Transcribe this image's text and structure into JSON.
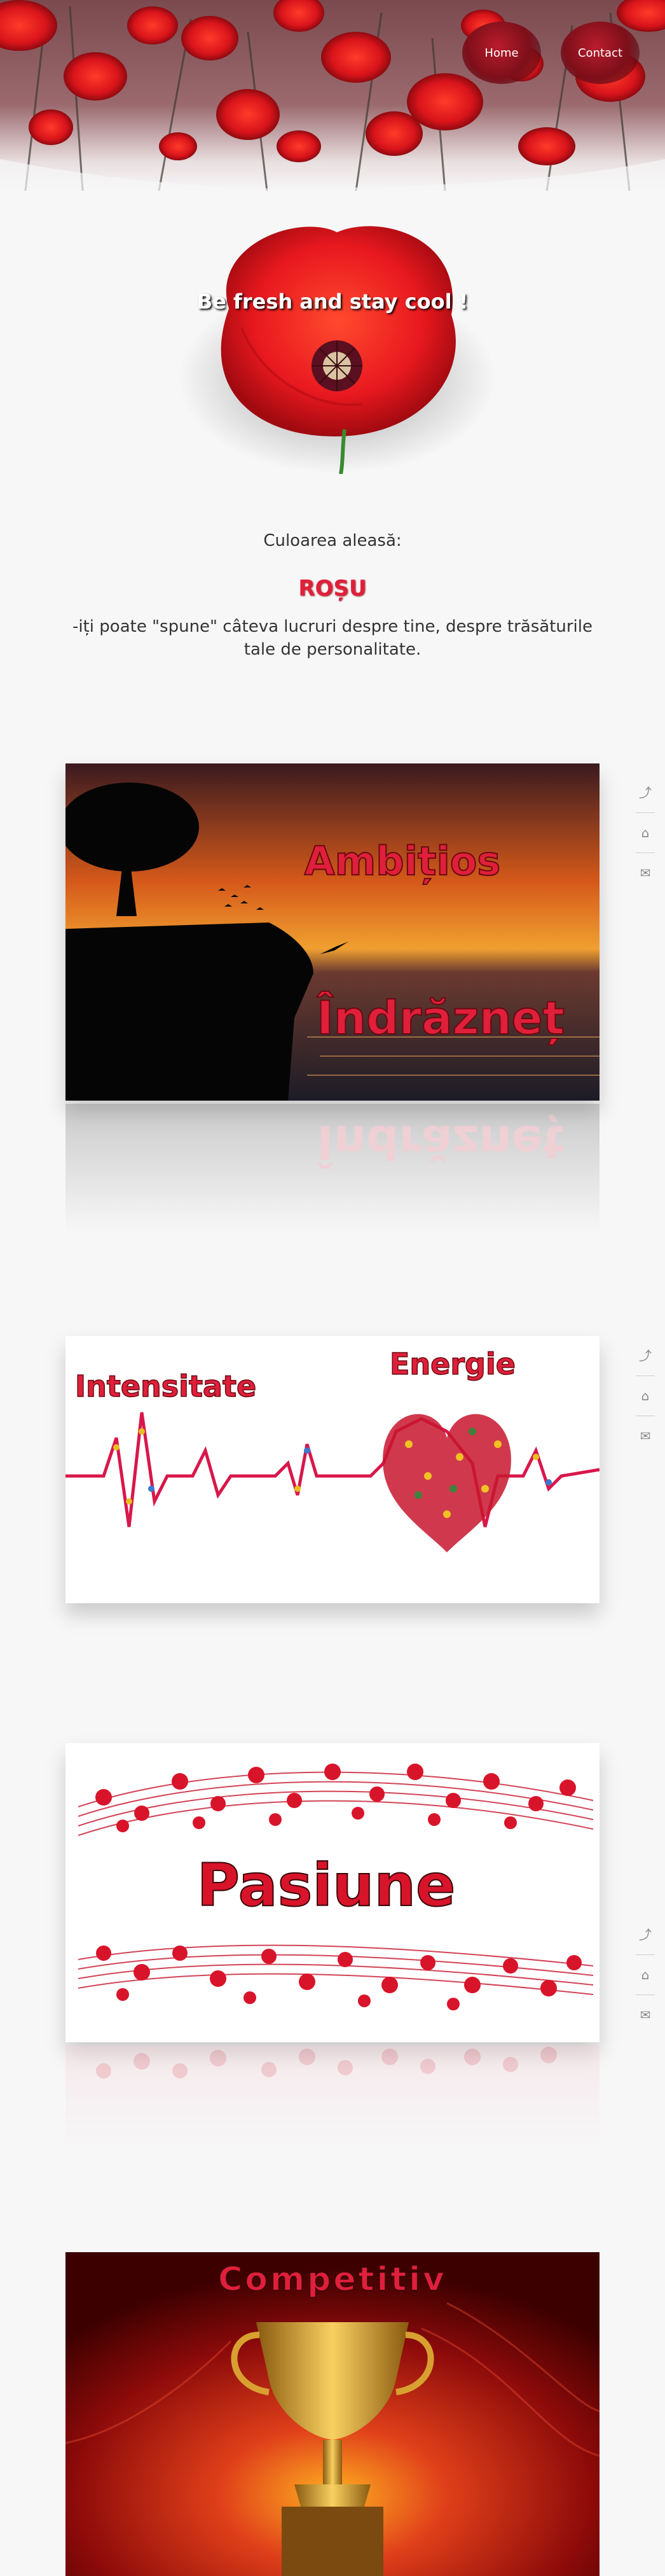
{
  "nav": {
    "home_label": "Home",
    "contact_label": "Contact"
  },
  "hero": {
    "tagline": "Be fresh and stay cool !"
  },
  "intro": {
    "label": "Culoarea aleasă:",
    "color_name": "ROȘU",
    "description": "-iți poate \"spune\" câteva lucruri despre tine, despre trăsăturile tale de personalitate."
  },
  "panels": {
    "p1": {
      "word1": "Ambițios",
      "word2": "Îndrăzneț"
    },
    "p2": {
      "word1": "Intensitate",
      "word2": "Energie"
    },
    "p3": {
      "word1": "Pasiune"
    },
    "p4": {
      "word1": "Competitiv"
    }
  },
  "side_icons": [
    "share-icon",
    "home-icon",
    "mail-icon"
  ],
  "colors": {
    "accent": "#e01f3a",
    "deep_red": "#8b0000",
    "bg": "#f7f7f8"
  }
}
